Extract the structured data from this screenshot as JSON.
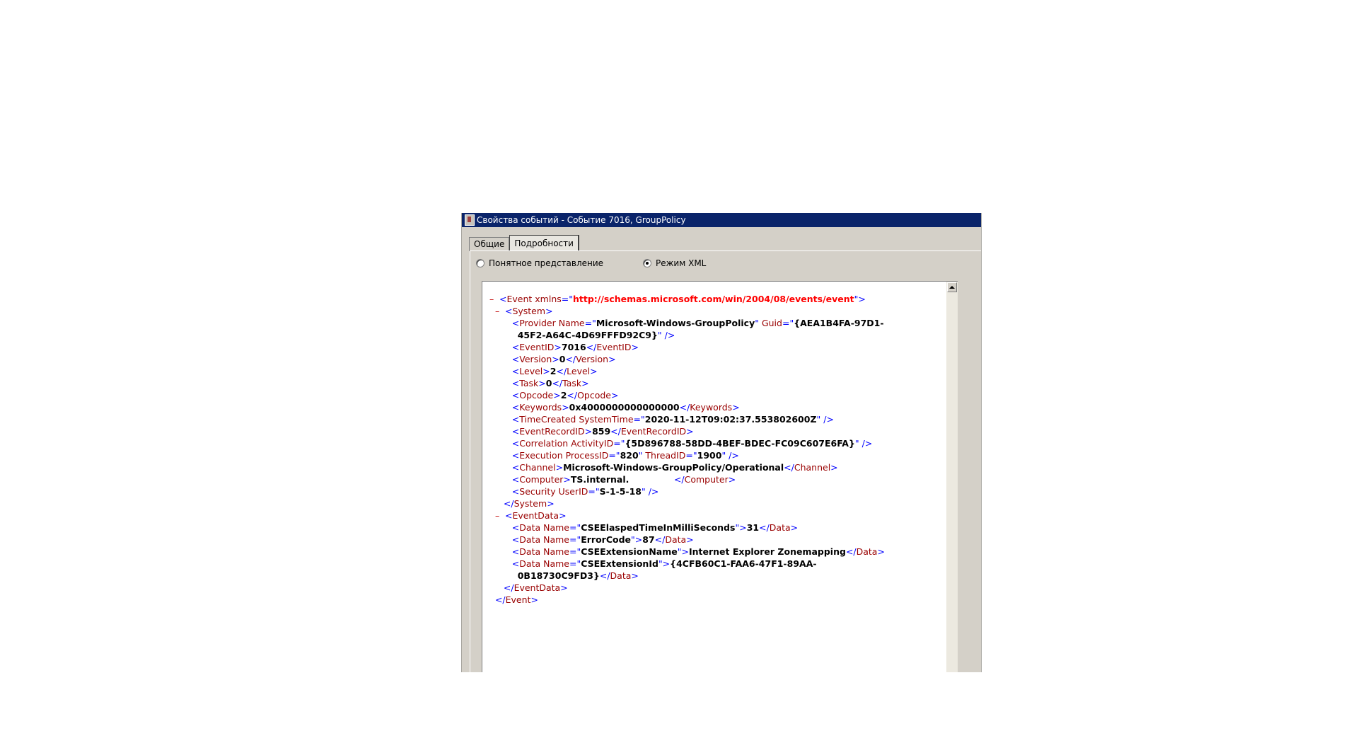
{
  "window": {
    "title": "Свойства событий - Событие 7016, GroupPolicy"
  },
  "tabs": [
    {
      "label": "Общие"
    },
    {
      "label": "Подробности"
    }
  ],
  "view_mode": {
    "friendly_label": "Понятное представление",
    "xml_label": "Режим XML",
    "selected": "xml"
  },
  "xml": {
    "event_ns": "http://schemas.microsoft.com/win/2004/08/events/event",
    "provider_name": "Microsoft-Windows-GroupPolicy",
    "guid_part1": "{AEA1B4FA-97D1-",
    "guid_part2": "45F2-A64C-4D69FFFD92C9}",
    "event_id": "7016",
    "version": "0",
    "level": "2",
    "task": "0",
    "opcode": "2",
    "keywords": "0x4000000000000000",
    "time_created": "2020-11-12T09:02:37.553802600Z",
    "event_record_id": "859",
    "activity_id": "{5D896788-58DD-4BEF-BDEC-FC09C607E6FA}",
    "process_id": "820",
    "thread_id": "1900",
    "channel": "Microsoft-Windows-GroupPolicy/Operational",
    "computer": "TS.internal.",
    "user_id": "S-1-5-18",
    "data": [
      {
        "name": "CSEElaspedTimeInMilliSeconds",
        "value": "31"
      },
      {
        "name": "ErrorCode",
        "value": "87"
      },
      {
        "name": "CSEExtensionName",
        "value": "Internet Explorer Zonemapping"
      },
      {
        "name": "CSEExtensionId",
        "value_part1": "{4CFB60C1-FAA6-47F1-89AA-",
        "value_part2": "0B18730C9FD3}"
      }
    ]
  }
}
